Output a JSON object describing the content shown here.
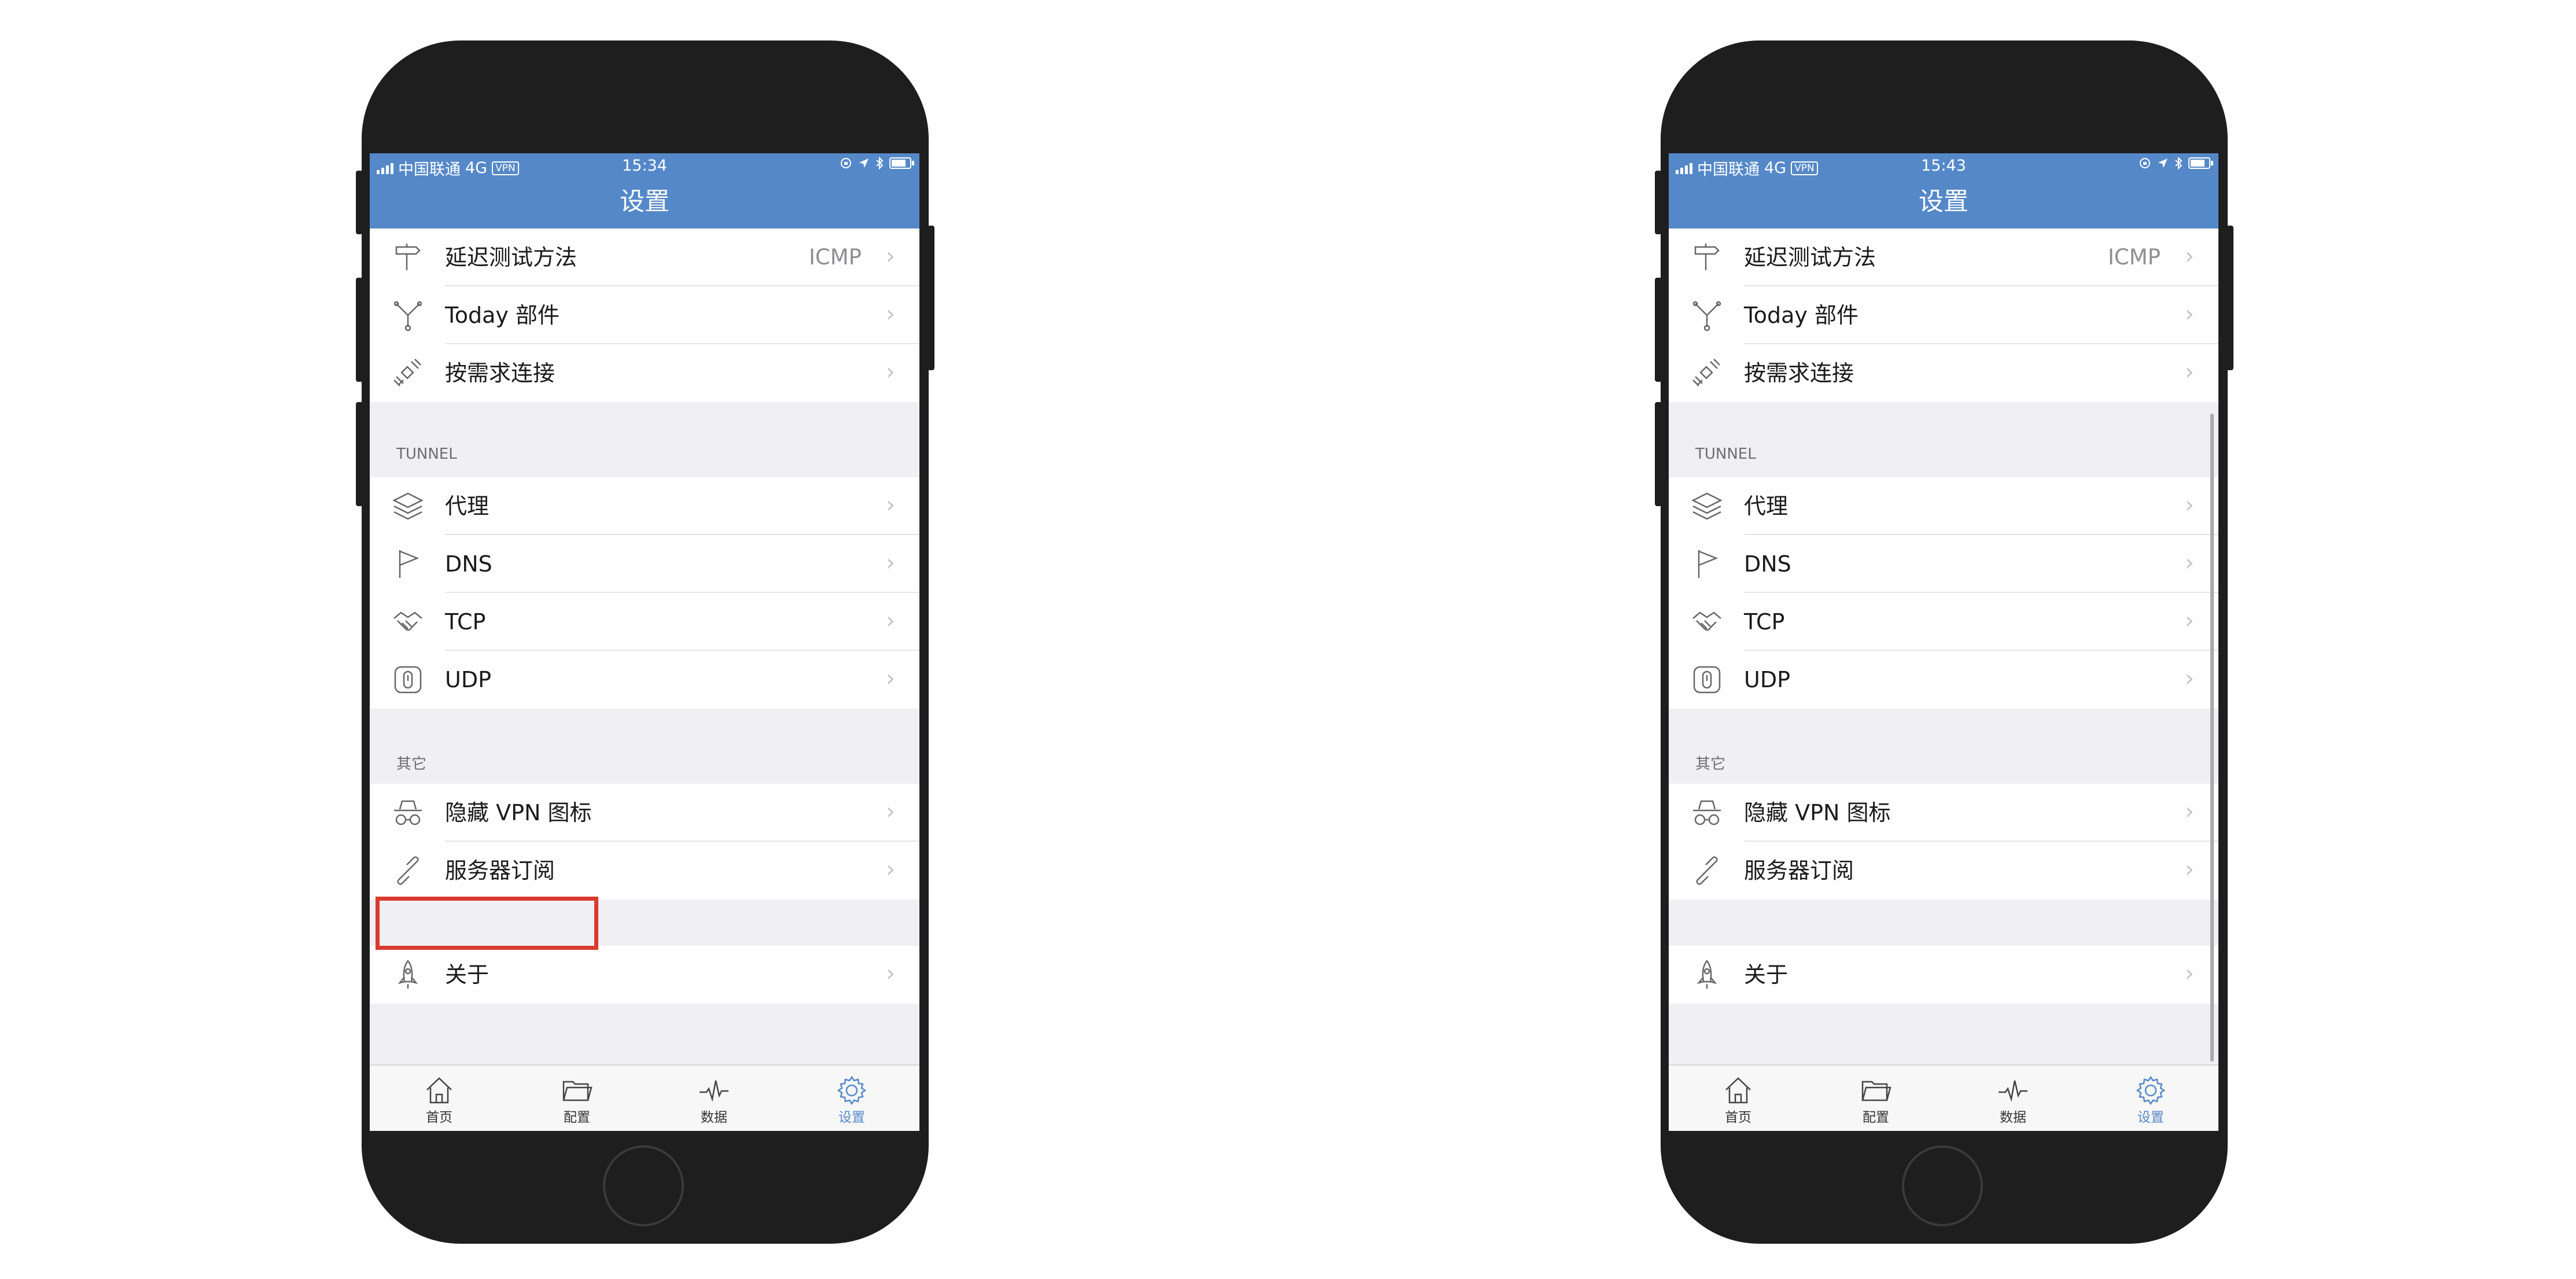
{
  "phones": [
    {
      "status": {
        "carrier": "中国联通",
        "network": "4G",
        "vpn": "VPN",
        "time": "15:34"
      },
      "nav_title": "设置",
      "rows": {
        "latency": {
          "label": "延迟测试方法",
          "value": "ICMP"
        },
        "today": {
          "label": "Today 部件"
        },
        "ondemand": {
          "label": "按需求连接"
        },
        "proxy": {
          "label": "代理"
        },
        "dns": {
          "label": "DNS"
        },
        "tcp": {
          "label": "TCP"
        },
        "udp": {
          "label": "UDP"
        },
        "hidevpn": {
          "label": "隐藏 VPN 图标"
        },
        "subscription": {
          "label": "服务器订阅"
        },
        "about": {
          "label": "关于"
        }
      },
      "sections": {
        "tunnel": "TUNNEL",
        "other": "其它"
      },
      "tabs": {
        "home": "首页",
        "config": "配置",
        "data": "数据",
        "settings": "设置"
      },
      "highlighted_row": "服务器订阅"
    },
    {
      "status": {
        "carrier": "中国联通",
        "network": "4G",
        "vpn": "VPN",
        "time": "15:43"
      },
      "nav_title": "设置",
      "rows": {
        "latency": {
          "label": "延迟测试方法",
          "value": "ICMP"
        },
        "today": {
          "label": "Today 部件"
        },
        "ondemand": {
          "label": "按需求连接"
        },
        "proxy": {
          "label": "代理"
        },
        "dns": {
          "label": "DNS"
        },
        "tcp": {
          "label": "TCP"
        },
        "udp": {
          "label": "UDP"
        },
        "hidevpn": {
          "label": "隐藏 VPN 图标"
        },
        "subscription": {
          "label": "服务器订阅"
        },
        "about": {
          "label": "关于"
        }
      },
      "sections": {
        "tunnel": "TUNNEL",
        "other": "其它"
      },
      "tabs": {
        "home": "首页",
        "config": "配置",
        "data": "数据",
        "settings": "设置"
      }
    }
  ],
  "colors": {
    "accent": "#5588c8",
    "highlight": "#d93a2f",
    "background": "#efeff4"
  },
  "icons": {
    "latency": "signpost-icon",
    "today": "widget-branch-icon",
    "ondemand": "satellite-icon",
    "proxy": "layers-icon",
    "dns": "flag-icon",
    "tcp": "handshake-icon",
    "udp": "device-icon",
    "hidevpn": "incognito-icon",
    "subscription": "link-icon",
    "about": "rocket-icon"
  }
}
